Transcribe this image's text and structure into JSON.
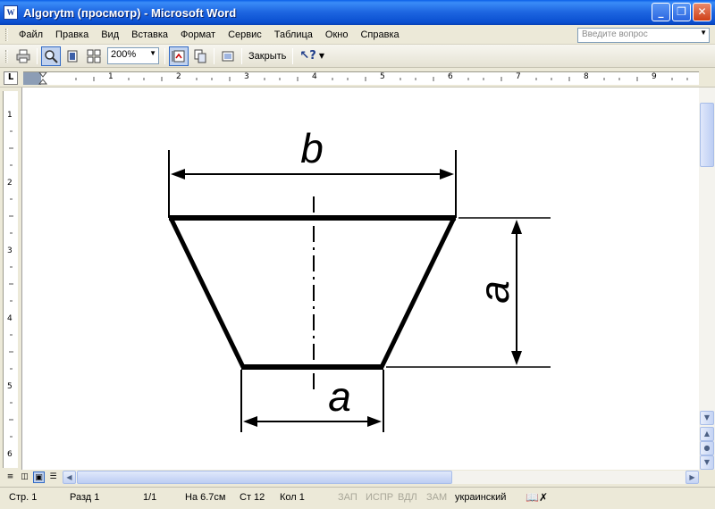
{
  "window": {
    "title": "Algorytm (просмотр) - Microsoft Word",
    "app_icon_letter": "W",
    "minimize_glyph": "_",
    "maximize_glyph": "❐",
    "close_glyph": "✕"
  },
  "menu": {
    "items": [
      "Файл",
      "Правка",
      "Вид",
      "Вставка",
      "Формат",
      "Сервис",
      "Таблица",
      "Окно",
      "Справка"
    ],
    "help_placeholder": "Введите вопрос"
  },
  "toolbar": {
    "zoom_value": "200%",
    "close_label": "Закрыть",
    "icons": [
      "print-icon",
      "magnifier-icon",
      "one-page-icon",
      "multiple-pages-icon",
      "shrink-to-fit-icon",
      "full-screen-icon",
      "help-icon"
    ]
  },
  "hruler": {
    "labels": [
      "1",
      "2",
      "3",
      "4",
      "5",
      "6",
      "7",
      "8",
      "9"
    ],
    "corner_glyph": "L"
  },
  "vruler": {
    "labels": [
      "1",
      "2",
      "3",
      "4",
      "5",
      "6"
    ]
  },
  "figure": {
    "top_label": "b",
    "right_label": "a",
    "bottom_label": "a"
  },
  "statusbar": {
    "page": "Стр. 1",
    "section": "Разд 1",
    "pages": "1/1",
    "at": "На 6.7см",
    "line": "Ст 12",
    "col": "Кол 1",
    "rec": "ЗАП",
    "trk": "ИСПР",
    "ext": "ВДЛ",
    "ovr": "ЗАМ",
    "language": "украинский"
  }
}
